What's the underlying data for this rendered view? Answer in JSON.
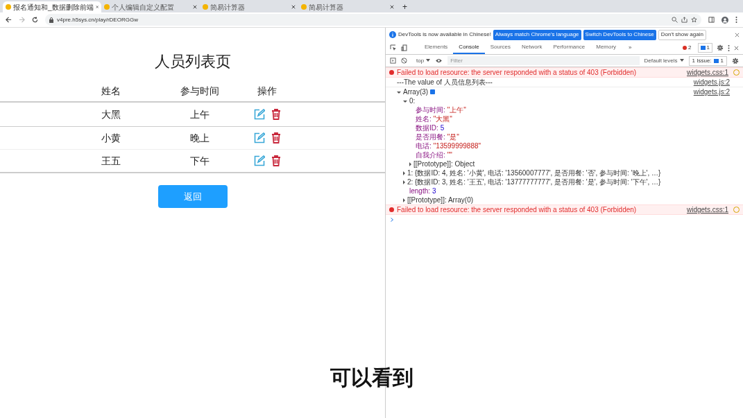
{
  "tabs": [
    {
      "title": "报名通知和_数据删除前端",
      "selected": true
    },
    {
      "title": "个人编辑自定义配置",
      "selected": false
    },
    {
      "title": "简易计算器",
      "selected": false
    },
    {
      "title": "简易计算器",
      "selected": false
    }
  ],
  "new_tab": "+",
  "address": "v4pre.h5sys.cn/play/rDEORGGw",
  "page": {
    "title": "人员列表页",
    "columns": [
      "姓名",
      "参与时间",
      "操作"
    ],
    "rows": [
      {
        "name": "大黑",
        "time": "上午"
      },
      {
        "name": "小黄",
        "time": "晚上"
      },
      {
        "name": "王五",
        "time": "下午"
      }
    ],
    "back_button": "返回"
  },
  "devtools": {
    "banner": {
      "text": "DevTools is now available in Chinese!",
      "buttons": [
        "Always match Chrome's language",
        "Switch DevTools to Chinese",
        "Don't show again"
      ]
    },
    "tabs": [
      {
        "label": "Elements",
        "selected": false
      },
      {
        "label": "Console",
        "selected": true
      },
      {
        "label": "Sources",
        "selected": false
      },
      {
        "label": "Network",
        "selected": false
      },
      {
        "label": "Performance",
        "selected": false
      },
      {
        "label": "Memory",
        "selected": false
      }
    ],
    "more": "»",
    "errors": "2",
    "messages": "1",
    "context": "top",
    "filter_placeholder": "Filter",
    "levels": "Default levels",
    "issues_label": "1 Issue:",
    "issues_count": "1",
    "console": [
      {
        "kind": "error",
        "text": "Failed to load resource: the server responded with a status of 403 (Forbidden)",
        "source": "widgets.css:1"
      },
      {
        "kind": "log",
        "text": "---The value of 人员信息列表---",
        "source": "widgets.js:2"
      },
      {
        "kind": "object",
        "source": "widgets.js:2",
        "tree": [
          {
            "label": "Array(3)",
            "expanded": true,
            "children": [
              {
                "label": "0:",
                "expanded": true,
                "children": [
                  {
                    "key": "参与时间:",
                    "value": "\"上午\""
                  },
                  {
                    "key": "姓名:",
                    "value": "\"大黑\""
                  },
                  {
                    "key": "数据ID:",
                    "value": "5"
                  },
                  {
                    "key": "是否用餐:",
                    "value": "\"是\""
                  },
                  {
                    "key": "电话:",
                    "value": "\"13599999888\""
                  },
                  {
                    "key": "自我介绍:",
                    "value": "\"\""
                  },
                  {
                    "label": "[[Prototype]]: Object",
                    "expanded": false
                  }
                ]
              },
              {
                "label": "1: {数据ID: 4, 姓名: '小黄', 电话: '13560007777', 是否用餐: '否', 参与时间: '晚上', …}",
                "expanded": false
              },
              {
                "label": "2: {数据ID: 3, 姓名: '王五', 电话: '13777777777', 是否用餐: '是', 参与时间: '下午', …}",
                "expanded": false
              },
              {
                "key": "length:",
                "value": "3"
              },
              {
                "label": "[[Prototype]]: Array(0)",
                "expanded": false
              }
            ]
          }
        ]
      },
      {
        "kind": "error",
        "text": "Failed to load resource: the server responded with a status of 403 (Forbidden)",
        "source": "widgets.css:1"
      }
    ]
  },
  "subtitle": "可以看到"
}
